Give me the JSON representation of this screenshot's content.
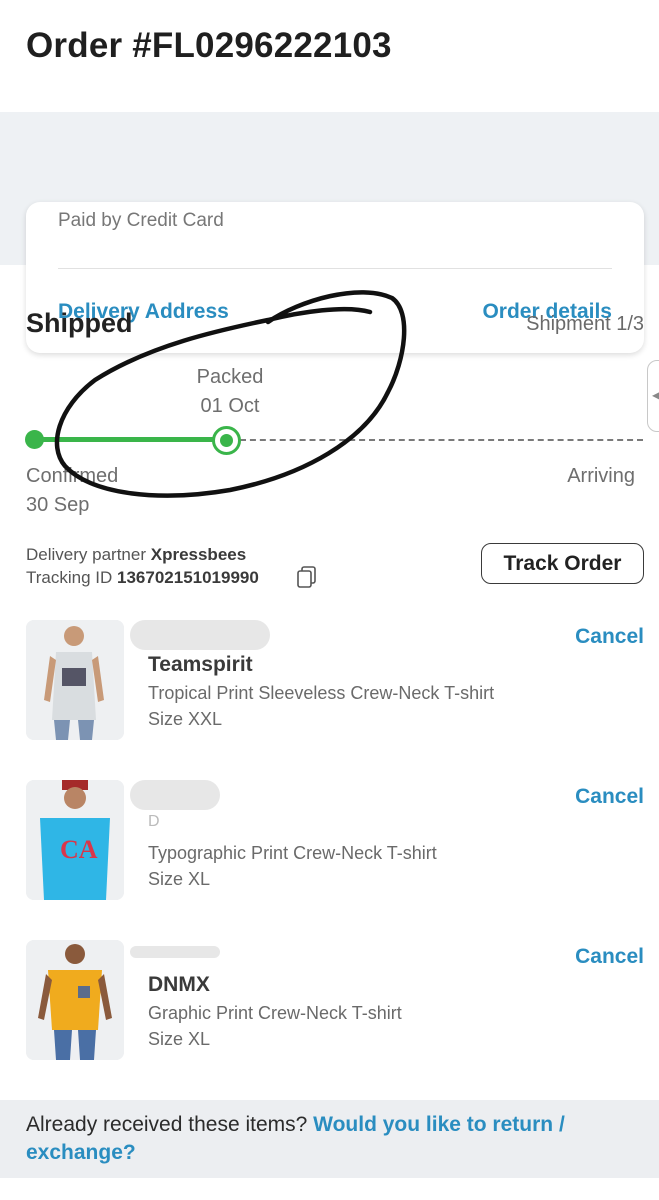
{
  "header": {
    "order_title": "Order #FL0296222103"
  },
  "summary": {
    "paid_by": "Paid by Credit Card",
    "delivery_address_link": "Delivery Address",
    "order_details_link": "Order details"
  },
  "shipment": {
    "status": "Shipped",
    "count_label": "Shipment 1/3",
    "steps": [
      {
        "name": "Confirmed",
        "date": "30 Sep"
      },
      {
        "name": "Packed",
        "date": "01 Oct"
      },
      {
        "name": "Arriving",
        "date": ""
      }
    ],
    "partner_label": "Delivery partner",
    "partner_name": "Xpressbees",
    "tracking_label": "Tracking ID",
    "tracking_id": "136702151019990",
    "track_button": "Track Order"
  },
  "items": [
    {
      "brand": "Teamspirit",
      "description": "Tropical Print Sleeveless Crew-Neck T-shirt",
      "size": "Size XXL",
      "action": "Cancel",
      "shirt_color": "#d9dde0"
    },
    {
      "brand": "D",
      "description": "Typographic Print Crew-Neck T-shirt",
      "size": "Size XL",
      "action": "Cancel",
      "shirt_color": "#2fb6e6"
    },
    {
      "brand": "DNMX",
      "description": "Graphic Print Crew-Neck T-shirt",
      "size": "Size XL",
      "action": "Cancel",
      "shirt_color": "#f0ab1e"
    }
  ],
  "return_banner": {
    "question": "Already received these items?",
    "link": "Would you like to return / exchange?"
  },
  "colors": {
    "accent_blue": "#2a8dc0",
    "progress_green": "#3ab54a",
    "annotation_ink": "#111111"
  }
}
